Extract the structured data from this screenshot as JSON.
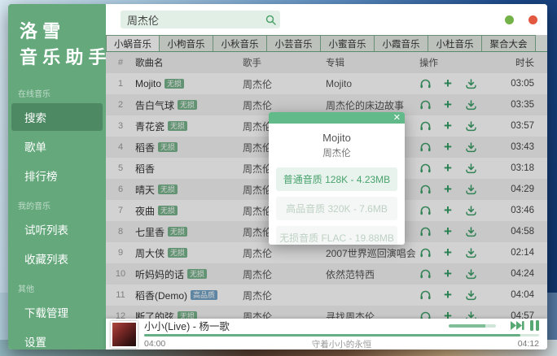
{
  "app": {
    "title_line1": "洛雪",
    "title_line2": "音乐助手"
  },
  "sidebar": {
    "sections": [
      {
        "label": "在线音乐",
        "items": [
          {
            "label": "搜索",
            "active": true
          },
          {
            "label": "歌单",
            "active": false
          },
          {
            "label": "排行榜",
            "active": false
          }
        ]
      },
      {
        "label": "我的音乐",
        "items": [
          {
            "label": "试听列表",
            "active": false
          },
          {
            "label": "收藏列表",
            "active": false
          }
        ]
      },
      {
        "label": "其他",
        "items": [
          {
            "label": "下载管理",
            "active": false
          },
          {
            "label": "设置",
            "active": false
          }
        ]
      }
    ]
  },
  "header": {
    "search_value": "周杰伦"
  },
  "window_controls": {
    "minimize_color": "#72b247",
    "close_color": "#e25840"
  },
  "tabs": [
    {
      "label": "小蜗音乐",
      "active": true
    },
    {
      "label": "小枸音乐",
      "active": false
    },
    {
      "label": "小秋音乐",
      "active": false
    },
    {
      "label": "小芸音乐",
      "active": false
    },
    {
      "label": "小蜜音乐",
      "active": false
    },
    {
      "label": "小霞音乐",
      "active": false
    },
    {
      "label": "小杜音乐",
      "active": false
    },
    {
      "label": "聚合大会",
      "active": false
    }
  ],
  "table": {
    "headers": {
      "num": "#",
      "name": "歌曲名",
      "artist": "歌手",
      "album": "专辑",
      "ops": "操作",
      "time": "时长"
    },
    "rows": [
      {
        "num": "1",
        "name": "Mojito",
        "badge": "无损",
        "badge_type": "lossless",
        "artist": "周杰伦",
        "album": "Mojito",
        "time": "03:05"
      },
      {
        "num": "2",
        "name": "告白气球",
        "badge": "无损",
        "badge_type": "lossless",
        "artist": "周杰伦",
        "album": "周杰伦的床边故事",
        "time": "03:35"
      },
      {
        "num": "3",
        "name": "青花瓷",
        "badge": "无损",
        "badge_type": "lossless",
        "artist": "周杰伦",
        "album": "",
        "time": "03:57"
      },
      {
        "num": "4",
        "name": "稻香",
        "badge": "无损",
        "badge_type": "lossless",
        "artist": "周杰伦",
        "album": "",
        "time": "03:43"
      },
      {
        "num": "5",
        "name": "稻香",
        "badge": "",
        "badge_type": "",
        "artist": "周杰伦",
        "album": "",
        "time": "03:18"
      },
      {
        "num": "6",
        "name": "晴天",
        "badge": "无损",
        "badge_type": "lossless",
        "artist": "周杰伦",
        "album": "",
        "time": "04:29"
      },
      {
        "num": "7",
        "name": "夜曲",
        "badge": "无损",
        "badge_type": "lossless",
        "artist": "周杰伦",
        "album": "",
        "time": "03:46"
      },
      {
        "num": "8",
        "name": "七里香",
        "badge": "无损",
        "badge_type": "lossless",
        "artist": "周杰伦",
        "album": "",
        "time": "04:58"
      },
      {
        "num": "9",
        "name": "周大侠",
        "badge": "无损",
        "badge_type": "lossless",
        "artist": "周杰伦",
        "album": "2007世界巡回演唱会",
        "time": "02:14"
      },
      {
        "num": "10",
        "name": "听妈妈的话",
        "badge": "无损",
        "badge_type": "lossless",
        "artist": "周杰伦",
        "album": "依然范特西",
        "time": "04:24"
      },
      {
        "num": "11",
        "name": "稻香(Demo)",
        "badge": "高品质",
        "badge_type": "hq",
        "artist": "周杰伦",
        "album": "",
        "time": "04:04"
      },
      {
        "num": "12",
        "name": "断了的弦",
        "badge": "无损",
        "badge_type": "lossless",
        "artist": "周杰伦",
        "album": "寻找周杰伦",
        "time": "04:57"
      }
    ]
  },
  "modal": {
    "title": "Mojito",
    "artist": "周杰伦",
    "close_glyph": "✕",
    "options": [
      {
        "label": "普通音质 128K - 4.23MB",
        "enabled": true
      },
      {
        "label": "高品音质 320K - 7.6MB",
        "enabled": false
      },
      {
        "label": "无损音质 FLAC - 19.88MB",
        "enabled": false
      }
    ]
  },
  "player": {
    "song": "小小(Live) - 杨一歌",
    "current_time": "04:00",
    "lyric": "守着小小的永恒",
    "total_time": "04:12",
    "progress_percent": 95.2
  },
  "colors": {
    "accent_green": "#64a87c",
    "active_item": "#4d8a63",
    "modal_header": "#62b98a",
    "badge_lossless": "#76b18a",
    "badge_hq": "#72a0c2"
  }
}
